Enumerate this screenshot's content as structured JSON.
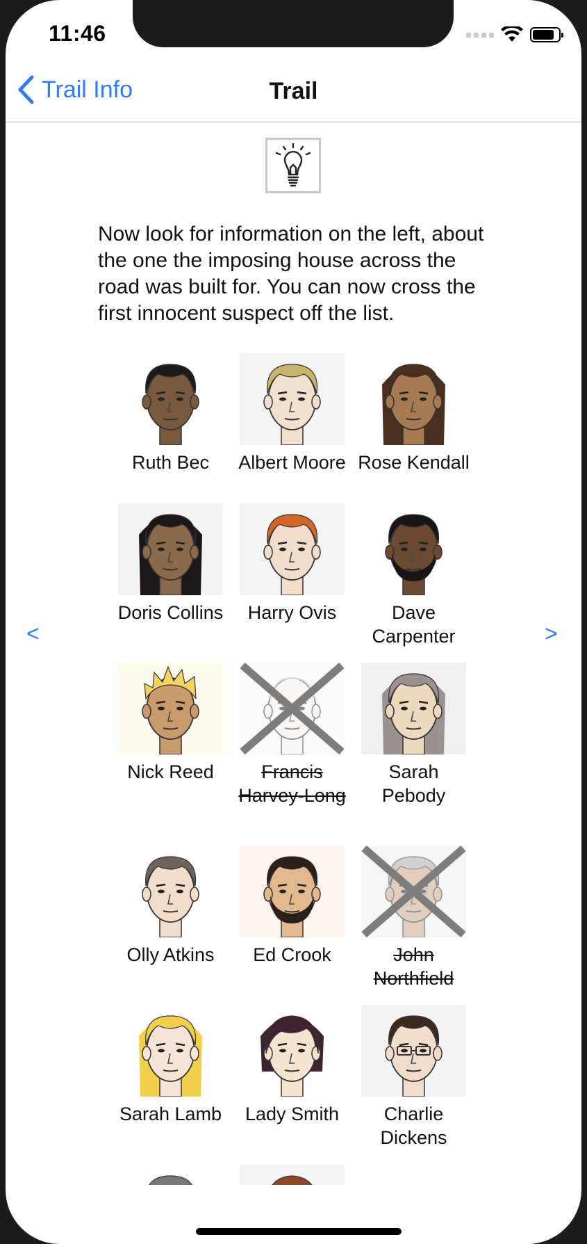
{
  "status_bar": {
    "time": "11:46"
  },
  "nav": {
    "back_label": "Trail Info",
    "title": "Trail"
  },
  "instruction": "Now look for information on the left, about the one the imposing house across the road was built for. You can now cross the first innocent suspect off the list.",
  "pager": {
    "prev": "<",
    "next": ">"
  },
  "suspects": [
    {
      "name": "Ruth Bec",
      "crossed": false,
      "skin": "#7a5a3e",
      "hair": "#1f1a1a",
      "bg": "#ffffff",
      "style": "short"
    },
    {
      "name": "Albert Moore",
      "crossed": false,
      "skin": "#f1e0cf",
      "hair": "#c8b46a",
      "bg": "#f3f4f5",
      "style": "short"
    },
    {
      "name": "Rose Kendall",
      "crossed": false,
      "skin": "#a67b52",
      "hair": "#4a2e1e",
      "bg": "#ffffff",
      "style": "long"
    },
    {
      "name": "Doris Collins",
      "crossed": false,
      "skin": "#8a6a4b",
      "hair": "#1e1717",
      "bg": "#f3f3f3",
      "style": "curly"
    },
    {
      "name": "Harry Ovis",
      "crossed": false,
      "skin": "#f2ddcc",
      "hair": "#d4652a",
      "bg": "#f3f4f5",
      "style": "short"
    },
    {
      "name": "Dave Carpenter",
      "crossed": false,
      "skin": "#6a4a32",
      "hair": "#1a1414",
      "bg": "#ffffff",
      "style": "beard"
    },
    {
      "name": "Nick Reed",
      "crossed": false,
      "skin": "#c89a6c",
      "hair": "#f2d560",
      "bg": "#fffaee",
      "style": "spiky"
    },
    {
      "name": "Francis Harvey-Long",
      "crossed": true,
      "skin": "#f4efea",
      "hair": "#d9d4cf",
      "bg": "#f7f8fa",
      "style": "bald"
    },
    {
      "name": "Sarah Pebody",
      "crossed": false,
      "skin": "#eed8bf",
      "hair": "#9c9290",
      "bg": "#f0f0f0",
      "style": "long"
    },
    {
      "name": "Olly Atkins",
      "crossed": false,
      "skin": "#f2ddca",
      "hair": "#6e645d",
      "bg": "#ffffff",
      "style": "short"
    },
    {
      "name": "Ed Crook",
      "crossed": false,
      "skin": "#e2b98d",
      "hair": "#2a1f1a",
      "bg": "#fdf6ef",
      "style": "beard"
    },
    {
      "name": "John Northfield",
      "crossed": true,
      "skin": "#c9a68a",
      "hair": "#aaaaaa",
      "bg": "#eeeeee",
      "style": "short"
    },
    {
      "name": "Sarah Lamb",
      "crossed": false,
      "skin": "#f6e5d6",
      "hair": "#f3d04b",
      "bg": "#ffffff",
      "style": "long"
    },
    {
      "name": "Lady Smith",
      "crossed": false,
      "skin": "#f3e3cf",
      "hair": "#3e2333",
      "bg": "#ffffff",
      "style": "bob"
    },
    {
      "name": "Charlie Dickens",
      "crossed": false,
      "skin": "#efdcca",
      "hair": "#3d2a1e",
      "bg": "#f2f3f4",
      "style": "glasses"
    },
    {
      "name": "",
      "crossed": false,
      "skin": "#e8d2c0",
      "hair": "#777777",
      "bg": "#ffffff",
      "style": "short"
    },
    {
      "name": "",
      "crossed": false,
      "skin": "#e8d2c0",
      "hair": "#8a4a2a",
      "bg": "#f3f4f5",
      "style": "bob"
    }
  ]
}
